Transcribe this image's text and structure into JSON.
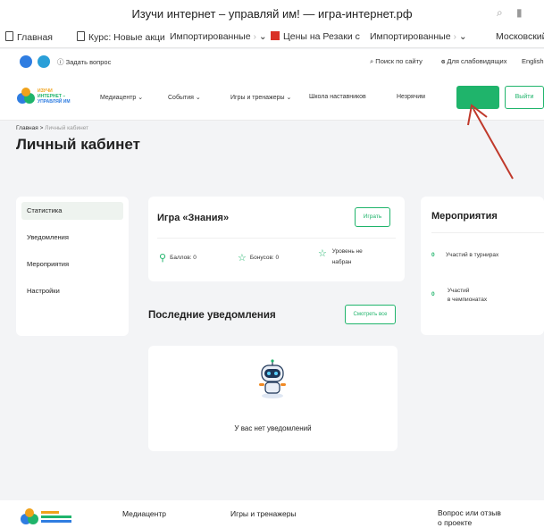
{
  "browser": {
    "title": "Изучи интернет – управляй им! — игра-интернет.рф",
    "bookmarks": [
      {
        "label": "Главная",
        "icon": "doc-icon"
      },
      {
        "label": "Курс: Новые акци",
        "icon": "doc-icon"
      },
      {
        "label": "Импортированные",
        "icon": "chevron-down"
      },
      {
        "label": "Цены на Резаки с",
        "icon": "red-square"
      },
      {
        "label": "Импортированные",
        "icon": "chevron-down"
      },
      {
        "label": "Московский",
        "icon": ""
      }
    ]
  },
  "utility": {
    "ask": "Задать вопрос",
    "search": "Поиск по сайту",
    "accessibility": "Для слабовидящих",
    "lang": "English"
  },
  "nav": {
    "logo_line1": "ИЗУЧИ",
    "logo_line2": "ИНТЕРНЕТ –",
    "logo_line3": "УПРАВЛЯЙ ИМ",
    "items": [
      "Медиацентр",
      "События",
      "Игры и тренажеры",
      "Школа наставников",
      "Незрячим"
    ],
    "logout": "Выйти"
  },
  "page": {
    "crumb_home": "Главная",
    "crumb_sep": ">",
    "crumb_current": "Личный кабинет",
    "title": "Личный кабинет"
  },
  "sidebar": [
    "Статистика",
    "Уведомления",
    "Мероприятия",
    "Настройки"
  ],
  "game": {
    "title": "Игра «Знания»",
    "play": "Играть",
    "points": "Баллов: 0",
    "bonuses": "Бонусов: 0",
    "level_line1": "Уровень не",
    "level_line2": "набран"
  },
  "events": {
    "title": "Мероприятия",
    "items": [
      {
        "count": "0",
        "label_line1": "Участий в турнирах",
        "label_line2": ""
      },
      {
        "count": "0",
        "label_line1": "Участий",
        "label_line2": "в чемпионатах"
      }
    ]
  },
  "notifications": {
    "title": "Последние уведомления",
    "see_all": "Смотреть все",
    "empty": "У вас нет уведомлений"
  },
  "footer": {
    "cols": [
      "Медиацентр",
      "Игры и тренажеры",
      "Вопрос или отзыв"
    ],
    "col3_line2": "о проекте"
  },
  "colors": {
    "accent": "#1fb46b",
    "annotation": "#c0392b",
    "page_bg": "#f3f4f6"
  }
}
